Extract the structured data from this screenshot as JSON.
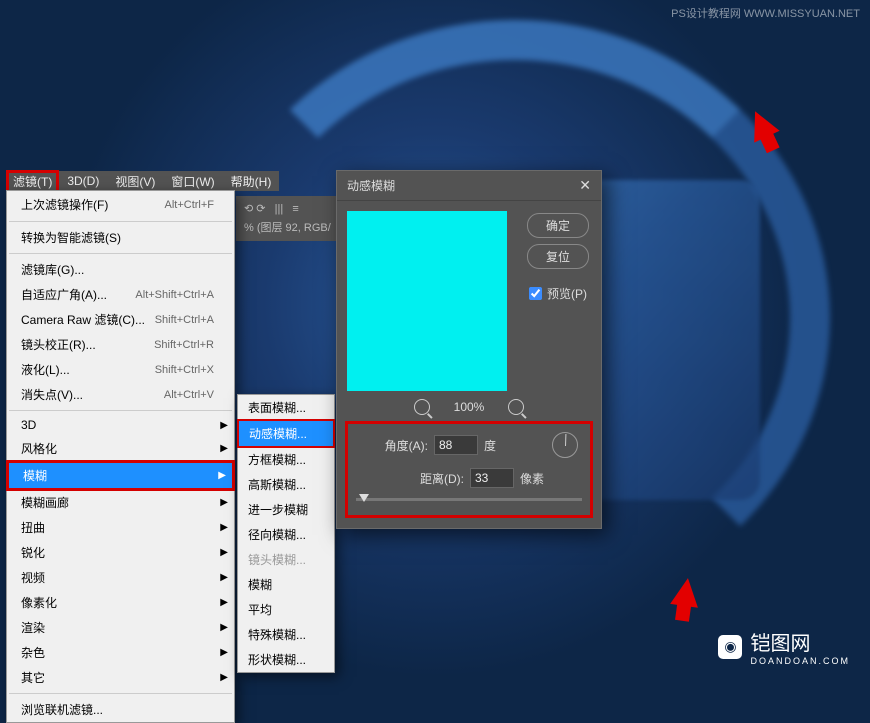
{
  "watermark": {
    "top": "PS设计教程网  WWW.MISSYUAN.NET",
    "bottom_main": "铠图网",
    "bottom_sub": "DOANDOAN.COM"
  },
  "menubar": {
    "filter": "滤镜(T)",
    "threeD": "3D(D)",
    "view": "视图(V)",
    "window": "窗口(W)",
    "help": "帮助(H)"
  },
  "toolbar_hint": "% (图层 92, RGB/",
  "menu": {
    "last_filter": "上次滤镜操作(F)",
    "last_filter_sc": "Alt+Ctrl+F",
    "smart": "转换为智能滤镜(S)",
    "gallery": "滤镜库(G)...",
    "adaptive": "自适应广角(A)...",
    "adaptive_sc": "Alt+Shift+Ctrl+A",
    "camera": "Camera Raw 滤镜(C)...",
    "camera_sc": "Shift+Ctrl+A",
    "lens": "镜头校正(R)...",
    "lens_sc": "Shift+Ctrl+R",
    "liquify": "液化(L)...",
    "liquify_sc": "Shift+Ctrl+X",
    "vanish": "消失点(V)...",
    "vanish_sc": "Alt+Ctrl+V",
    "threeD": "3D",
    "stylize": "风格化",
    "blur": "模糊",
    "blur_gallery": "模糊画廊",
    "distort": "扭曲",
    "sharpen": "锐化",
    "video": "视频",
    "pixelate": "像素化",
    "render": "渲染",
    "noise": "杂色",
    "other": "其它",
    "browse": "浏览联机滤镜..."
  },
  "submenu": {
    "surface": "表面模糊...",
    "motion": "动感模糊...",
    "box": "方框模糊...",
    "gaussian": "高斯模糊...",
    "further": "进一步模糊",
    "radial": "径向模糊...",
    "lens": "镜头模糊...",
    "blur": "模糊",
    "average": "平均",
    "special": "特殊模糊...",
    "shape": "形状模糊..."
  },
  "dialog": {
    "title": "动感模糊",
    "ok": "确定",
    "reset": "复位",
    "preview": "预览(P)",
    "zoom": "100%",
    "angle_label": "角度(A):",
    "angle_value": "88",
    "angle_unit": "度",
    "distance_label": "距离(D):",
    "distance_value": "33",
    "distance_unit": "像素"
  }
}
